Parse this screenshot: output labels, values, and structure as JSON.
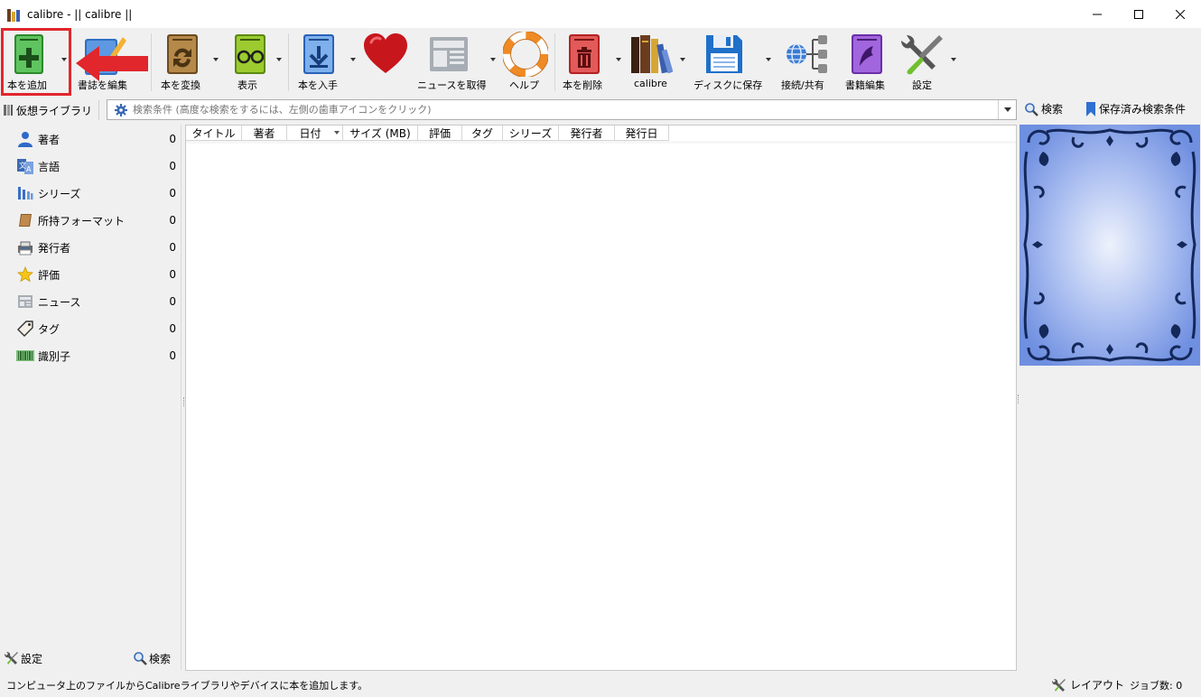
{
  "window": {
    "title": "calibre - || calibre ||"
  },
  "toolbar": {
    "add_book": "本を追加",
    "edit_metadata": "書誌を編集",
    "convert": "本を変換",
    "view": "表示",
    "get_books": "本を入手",
    "fetch_news": "ニュースを取得",
    "help": "ヘルプ",
    "remove": "本を削除",
    "library": "calibre",
    "save_to_disk": "ディスクに保存",
    "connect_share": "接続/共有",
    "edit_book": "書籍編集",
    "preferences": "設定"
  },
  "search": {
    "virtual_library": "仮想ライブラリ",
    "placeholder": "検索条件 (高度な検索をするには、左側の歯車アイコンをクリック)",
    "search_label": "検索",
    "saved_searches": "保存済み検索条件"
  },
  "tag_browser": {
    "categories": [
      {
        "name": "著者",
        "count": "0"
      },
      {
        "name": "言語",
        "count": "0"
      },
      {
        "name": "シリーズ",
        "count": "0"
      },
      {
        "name": "所持フォーマット",
        "count": "0"
      },
      {
        "name": "発行者",
        "count": "0"
      },
      {
        "name": "評価",
        "count": "0"
      },
      {
        "name": "ニュース",
        "count": "0"
      },
      {
        "name": "タグ",
        "count": "0"
      },
      {
        "name": "識別子",
        "count": "0"
      }
    ],
    "settings_label": "設定",
    "find_label": "検索"
  },
  "book_list": {
    "columns": [
      "タイトル",
      "著者",
      "日付",
      "サイズ (MB)",
      "評価",
      "タグ",
      "シリーズ",
      "発行者",
      "発行日"
    ]
  },
  "statusbar": {
    "message": "コンピュータ上のファイルからCalibreライブラリやデバイスに本を追加します。",
    "layout": "レイアウト",
    "jobs": "ジョブ数: 0"
  },
  "colors": {
    "highlight": "#e1262c",
    "cover_bg": "#8fa8e8"
  }
}
